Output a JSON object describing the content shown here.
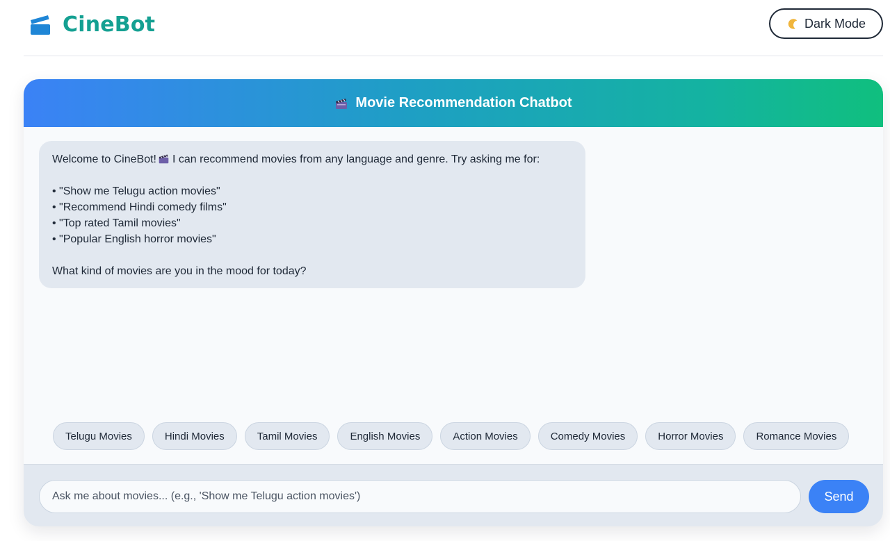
{
  "header": {
    "app_name": "CineBot",
    "brand_icon": "clapperboard-icon",
    "dark_mode_label": "Dark Mode",
    "dark_mode_icon": "moon-icon"
  },
  "chat": {
    "title": "Movie Recommendation Chatbot",
    "title_icon": "clapperboard-icon",
    "welcome_message": {
      "intro_before_icon": "Welcome to CineBot!",
      "intro_after_icon": "I can recommend movies from any language and genre. Try asking me for:",
      "examples": [
        "• \"Show me Telugu action movies\"",
        "• \"Recommend Hindi comedy films\"",
        "• \"Top rated Tamil movies\"",
        "• \"Popular English horror movies\""
      ],
      "closing": "What kind of movies are you in the mood for today?"
    },
    "quick_replies": [
      "Telugu Movies",
      "Hindi Movies",
      "Tamil Movies",
      "English Movies",
      "Action Movies",
      "Comedy Movies",
      "Horror Movies",
      "Romance Movies"
    ],
    "input": {
      "placeholder": "Ask me about movies... (e.g., 'Show me Telugu action movies')",
      "value": ""
    },
    "send_label": "Send"
  },
  "colors": {
    "brand": "#14a092",
    "accent": "#3b82f6",
    "header_gradient_start": "#3b82f6",
    "header_gradient_end": "#10bf7e",
    "bubble_bg": "#e2e8f0"
  }
}
